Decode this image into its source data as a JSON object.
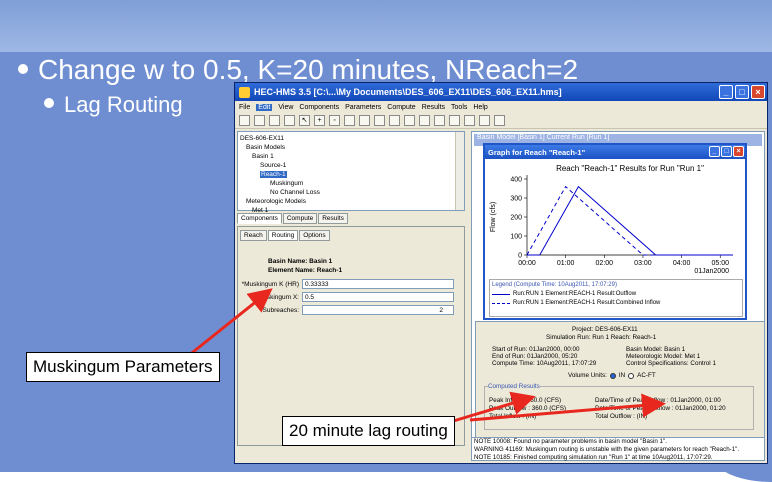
{
  "slide": {
    "heading": "Change w to 0.5, K=20 minutes, NReach=2",
    "subheading": "Lag Routing"
  },
  "callouts": {
    "muskingum": "Muskingum Parameters",
    "lag": "20 minute lag routing"
  },
  "app": {
    "title": "HEC-HMS 3.5 [C:\\...\\My Documents\\DES_606_EX11\\DES_606_EX11.hms]",
    "menu": [
      "File",
      "Edit",
      "View",
      "Components",
      "Parameters",
      "Compute",
      "Results",
      "Tools",
      "Help"
    ],
    "active_menu": "Edit",
    "tree": [
      "DES-606-EX11",
      "Basin Models",
      "Basin 1",
      "Source-1",
      "Reach-1",
      "Muskingum",
      "No Channel Loss",
      "Meteorologic Models",
      "Met 1"
    ],
    "tabs": [
      "Components",
      "Compute",
      "Results"
    ],
    "editor_tabs": [
      "Reach",
      "Routing",
      "Options"
    ],
    "basin_name_label": "Basin Name: Basin 1",
    "element_name_label": "Element Name: Reach-1",
    "params": {
      "k_label": "*Muskingum K (HR)",
      "k_value": "0.33333",
      "x_label": "*Muskingum X:",
      "x_value": "0.5",
      "subreaches_label": "Subreaches:",
      "subreaches_value": "2"
    },
    "bg_window_title": "Basin Model [Basin 1] Current Run [Run 1]",
    "graph": {
      "window_title": "Graph for Reach \"Reach-1\"",
      "legend_title": "Legend (Compute Time: 10Aug2011, 17:07:29)",
      "legend1": "Run:RUN 1 Element:REACH-1 Result:Outflow",
      "legend2": "Run:RUN 1 Element:REACH-1 Result:Combined Inflow"
    },
    "summary": {
      "project": "Project: DES-606-EX11",
      "sim": "Simulation Run: Run 1    Reach: Reach-1",
      "start": "Start of Run:   01Jan2000, 00:00",
      "end": "End of Run:     01Jan2000, 05:20",
      "compute": "Compute Time: 10Aug2011, 17:07:29",
      "basin_model": "Basin Model:            Basin 1",
      "met_model": "Meteorologic Model:   Met 1",
      "control": "Control Specifications: Control 1",
      "volume_units": "Volume Units:",
      "unit_in": "IN",
      "unit_acft": "AC-FT",
      "computed": "Computed Results",
      "peak_inflow": "Peak Inflow :   360.0 (CFS)",
      "peak_outflow": "Peak Outflow : 360.0 (CFS)",
      "total_inflow": "Total Inflow :        (IN)",
      "date_peak_inflow": "Date/Time of Peak Inflow :   01Jan2000, 01:00",
      "date_peak_outflow": "Date/Time of Peak Outflow : 01Jan2000, 01:20",
      "total_outflow": "Total Outflow :        (IN)"
    },
    "log": [
      "NOTE 10008: Found no parameter problems in basin model \"Basin 1\".",
      "WARNING 41169: Muskingum routing is unstable with the given parameters for reach \"Reach-1\".",
      "NOTE 10185: Finished computing simulation run \"Run 1\" at time 10Aug2011, 17:07:29."
    ]
  },
  "chart_data": {
    "type": "line",
    "title": "Reach \"Reach-1\" Results for Run \"Run 1\"",
    "ylabel": "Flow (cfs)",
    "xlabel": "",
    "ylim": [
      0,
      400
    ],
    "yticks": [
      0,
      100,
      200,
      300,
      400
    ],
    "xtick_labels": [
      "00:00",
      "01:00",
      "02:00",
      "03:00",
      "04:00",
      "05:00"
    ],
    "x_sublabel": "01Jan2000",
    "xlim_hours": [
      0,
      5.33
    ],
    "series": [
      {
        "name": "Run:RUN 1 Element:REACH-1 Result:Outflow",
        "style": "solid",
        "color": "#0000cc",
        "x": [
          0,
          0.33,
          1.33,
          3.33,
          5.33
        ],
        "y": [
          0,
          0,
          360,
          0,
          0
        ]
      },
      {
        "name": "Run:RUN 1 Element:REACH-1 Result:Combined Inflow",
        "style": "dashed",
        "color": "#0000cc",
        "x": [
          0,
          1.0,
          3.0,
          5.33
        ],
        "y": [
          0,
          360,
          0,
          0
        ]
      }
    ],
    "grid": false,
    "legend_position": "bottom"
  }
}
